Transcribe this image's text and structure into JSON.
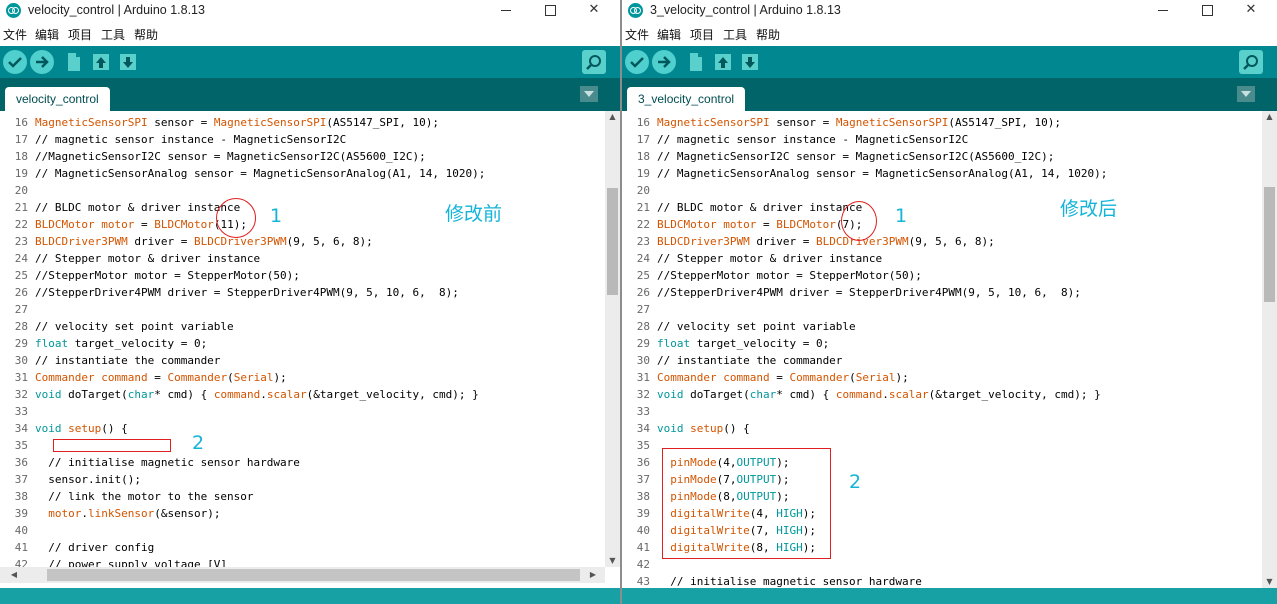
{
  "windows": {
    "left": {
      "title": "velocity_control | Arduino 1.8.13",
      "tab_label": "velocity_control",
      "menu": [
        "文件",
        "编辑",
        "项目",
        "工具",
        "帮助"
      ],
      "code_lines": [
        {
          "n": "16",
          "tokens": [
            {
              "t": "MagneticSensorSPI",
              "c": "o"
            },
            {
              "t": " sensor = ",
              "c": "p"
            },
            {
              "t": "MagneticSensorSPI",
              "c": "o"
            },
            {
              "t": "(AS5147_SPI, 10);",
              "c": "p"
            }
          ]
        },
        {
          "n": "17",
          "tokens": [
            {
              "t": "// magnetic sensor instance - MagneticSensorI2C",
              "c": "p"
            }
          ]
        },
        {
          "n": "18",
          "tokens": [
            {
              "t": "//MagneticSensorI2C sensor = MagneticSensorI2C(AS5600_I2C);",
              "c": "p"
            }
          ]
        },
        {
          "n": "19",
          "tokens": [
            {
              "t": "// MagneticSensorAnalog sensor = MagneticSensorAnalog(A1, 14, 1020);",
              "c": "p"
            }
          ]
        },
        {
          "n": "20",
          "tokens": []
        },
        {
          "n": "21",
          "tokens": [
            {
              "t": "// BLDC motor & driver instance",
              "c": "p"
            }
          ]
        },
        {
          "n": "22",
          "tokens": [
            {
              "t": "BLDCMotor",
              "c": "o"
            },
            {
              "t": " ",
              "c": "p"
            },
            {
              "t": "motor",
              "c": "o"
            },
            {
              "t": " = ",
              "c": "p"
            },
            {
              "t": "BLDCMotor",
              "c": "o"
            },
            {
              "t": "(11);",
              "c": "p"
            }
          ]
        },
        {
          "n": "23",
          "tokens": [
            {
              "t": "BLDCDriver3PWM",
              "c": "o"
            },
            {
              "t": " driver = ",
              "c": "p"
            },
            {
              "t": "BLDCDriver3PWM",
              "c": "o"
            },
            {
              "t": "(9, 5, 6, 8);",
              "c": "p"
            }
          ]
        },
        {
          "n": "24",
          "tokens": [
            {
              "t": "// Stepper motor & driver instance",
              "c": "p"
            }
          ]
        },
        {
          "n": "25",
          "tokens": [
            {
              "t": "//StepperMotor motor = StepperMotor(50);",
              "c": "p"
            }
          ]
        },
        {
          "n": "26",
          "tokens": [
            {
              "t": "//StepperDriver4PWM driver = StepperDriver4PWM(9, 5, 10, 6,  8);",
              "c": "p"
            }
          ]
        },
        {
          "n": "27",
          "tokens": []
        },
        {
          "n": "28",
          "tokens": [
            {
              "t": "// velocity set point variable",
              "c": "p"
            }
          ]
        },
        {
          "n": "29",
          "tokens": [
            {
              "t": "float",
              "c": "b"
            },
            {
              "t": " target_velocity = 0;",
              "c": "p"
            }
          ]
        },
        {
          "n": "30",
          "tokens": [
            {
              "t": "// instantiate the commander",
              "c": "p"
            }
          ]
        },
        {
          "n": "31",
          "tokens": [
            {
              "t": "Commander",
              "c": "o"
            },
            {
              "t": " ",
              "c": "p"
            },
            {
              "t": "command",
              "c": "o"
            },
            {
              "t": " = ",
              "c": "p"
            },
            {
              "t": "Commander",
              "c": "o"
            },
            {
              "t": "(",
              "c": "p"
            },
            {
              "t": "Serial",
              "c": "o"
            },
            {
              "t": ");",
              "c": "p"
            }
          ]
        },
        {
          "n": "32",
          "tokens": [
            {
              "t": "void",
              "c": "b"
            },
            {
              "t": " doTarget(",
              "c": "p"
            },
            {
              "t": "char",
              "c": "b"
            },
            {
              "t": "* cmd) { ",
              "c": "p"
            },
            {
              "t": "command",
              "c": "o"
            },
            {
              "t": ".",
              "c": "p"
            },
            {
              "t": "scalar",
              "c": "o"
            },
            {
              "t": "(&target_velocity, cmd); }",
              "c": "p"
            }
          ]
        },
        {
          "n": "33",
          "tokens": []
        },
        {
          "n": "34",
          "tokens": [
            {
              "t": "void",
              "c": "b"
            },
            {
              "t": " ",
              "c": "p"
            },
            {
              "t": "setup",
              "c": "o"
            },
            {
              "t": "() {",
              "c": "p"
            }
          ]
        },
        {
          "n": "35",
          "tokens": []
        },
        {
          "n": "36",
          "tokens": [
            {
              "t": "  // initialise magnetic sensor hardware",
              "c": "p"
            }
          ]
        },
        {
          "n": "37",
          "tokens": [
            {
              "t": "  sensor.init();",
              "c": "p"
            }
          ]
        },
        {
          "n": "38",
          "tokens": [
            {
              "t": "  // link the motor to the sensor",
              "c": "p"
            }
          ]
        },
        {
          "n": "39",
          "tokens": [
            {
              "t": "  ",
              "c": "p"
            },
            {
              "t": "motor",
              "c": "o"
            },
            {
              "t": ".",
              "c": "p"
            },
            {
              "t": "linkSensor",
              "c": "o"
            },
            {
              "t": "(&sensor);",
              "c": "p"
            }
          ]
        },
        {
          "n": "40",
          "tokens": []
        },
        {
          "n": "41",
          "tokens": [
            {
              "t": "  // driver config",
              "c": "p"
            }
          ]
        },
        {
          "n": "42",
          "tokens": [
            {
              "t": "  // power supply voltage [V]",
              "c": "p"
            }
          ]
        }
      ],
      "annotations": {
        "num1": "1",
        "num2": "2",
        "label": "修改前"
      }
    },
    "right": {
      "title": "3_velocity_control | Arduino 1.8.13",
      "tab_label": "3_velocity_control",
      "menu": [
        "文件",
        "编辑",
        "项目",
        "工具",
        "帮助"
      ],
      "code_lines": [
        {
          "n": "16",
          "tokens": [
            {
              "t": "MagneticSensorSPI",
              "c": "o"
            },
            {
              "t": " sensor = ",
              "c": "p"
            },
            {
              "t": "MagneticSensorSPI",
              "c": "o"
            },
            {
              "t": "(AS5147_SPI, 10);",
              "c": "p"
            }
          ]
        },
        {
          "n": "17",
          "tokens": [
            {
              "t": "// magnetic sensor instance - MagneticSensorI2C",
              "c": "p"
            }
          ]
        },
        {
          "n": "18",
          "tokens": [
            {
              "t": "// MagneticSensorI2C sensor = MagneticSensorI2C(AS5600_I2C);",
              "c": "p"
            }
          ]
        },
        {
          "n": "19",
          "tokens": [
            {
              "t": "// MagneticSensorAnalog sensor = MagneticSensorAnalog(A1, 14, 1020);",
              "c": "p"
            }
          ]
        },
        {
          "n": "20",
          "tokens": []
        },
        {
          "n": "21",
          "tokens": [
            {
              "t": "// BLDC motor & driver instance",
              "c": "p"
            }
          ]
        },
        {
          "n": "22",
          "tokens": [
            {
              "t": "BLDCMotor",
              "c": "o"
            },
            {
              "t": " ",
              "c": "p"
            },
            {
              "t": "motor",
              "c": "o"
            },
            {
              "t": " = ",
              "c": "p"
            },
            {
              "t": "BLDCMotor",
              "c": "o"
            },
            {
              "t": "(7);",
              "c": "p"
            }
          ]
        },
        {
          "n": "23",
          "tokens": [
            {
              "t": "BLDCDriver3PWM",
              "c": "o"
            },
            {
              "t": " driver = ",
              "c": "p"
            },
            {
              "t": "BLDCDriver3PWM",
              "c": "o"
            },
            {
              "t": "(9, 5, 6, 8);",
              "c": "p"
            }
          ]
        },
        {
          "n": "24",
          "tokens": [
            {
              "t": "// Stepper motor & driver instance",
              "c": "p"
            }
          ]
        },
        {
          "n": "25",
          "tokens": [
            {
              "t": "//StepperMotor motor = StepperMotor(50);",
              "c": "p"
            }
          ]
        },
        {
          "n": "26",
          "tokens": [
            {
              "t": "//StepperDriver4PWM driver = StepperDriver4PWM(9, 5, 10, 6,  8);",
              "c": "p"
            }
          ]
        },
        {
          "n": "27",
          "tokens": []
        },
        {
          "n": "28",
          "tokens": [
            {
              "t": "// velocity set point variable",
              "c": "p"
            }
          ]
        },
        {
          "n": "29",
          "tokens": [
            {
              "t": "float",
              "c": "b"
            },
            {
              "t": " target_velocity = 0;",
              "c": "p"
            }
          ]
        },
        {
          "n": "30",
          "tokens": [
            {
              "t": "// instantiate the commander",
              "c": "p"
            }
          ]
        },
        {
          "n": "31",
          "tokens": [
            {
              "t": "Commander",
              "c": "o"
            },
            {
              "t": " ",
              "c": "p"
            },
            {
              "t": "command",
              "c": "o"
            },
            {
              "t": " = ",
              "c": "p"
            },
            {
              "t": "Commander",
              "c": "o"
            },
            {
              "t": "(",
              "c": "p"
            },
            {
              "t": "Serial",
              "c": "o"
            },
            {
              "t": ");",
              "c": "p"
            }
          ]
        },
        {
          "n": "32",
          "tokens": [
            {
              "t": "void",
              "c": "b"
            },
            {
              "t": " doTarget(",
              "c": "p"
            },
            {
              "t": "char",
              "c": "b"
            },
            {
              "t": "* cmd) { ",
              "c": "p"
            },
            {
              "t": "command",
              "c": "o"
            },
            {
              "t": ".",
              "c": "p"
            },
            {
              "t": "scalar",
              "c": "o"
            },
            {
              "t": "(&target_velocity, cmd); }",
              "c": "p"
            }
          ]
        },
        {
          "n": "33",
          "tokens": []
        },
        {
          "n": "34",
          "tokens": [
            {
              "t": "void",
              "c": "b"
            },
            {
              "t": " ",
              "c": "p"
            },
            {
              "t": "setup",
              "c": "o"
            },
            {
              "t": "() {",
              "c": "p"
            }
          ]
        },
        {
          "n": "35",
          "tokens": []
        },
        {
          "n": "36",
          "tokens": [
            {
              "t": "  ",
              "c": "p"
            },
            {
              "t": "pinMode",
              "c": "o"
            },
            {
              "t": "(4,",
              "c": "p"
            },
            {
              "t": "OUTPUT",
              "c": "b"
            },
            {
              "t": ");",
              "c": "p"
            }
          ]
        },
        {
          "n": "37",
          "tokens": [
            {
              "t": "  ",
              "c": "p"
            },
            {
              "t": "pinMode",
              "c": "o"
            },
            {
              "t": "(7,",
              "c": "p"
            },
            {
              "t": "OUTPUT",
              "c": "b"
            },
            {
              "t": ");",
              "c": "p"
            }
          ]
        },
        {
          "n": "38",
          "tokens": [
            {
              "t": "  ",
              "c": "p"
            },
            {
              "t": "pinMode",
              "c": "o"
            },
            {
              "t": "(8,",
              "c": "p"
            },
            {
              "t": "OUTPUT",
              "c": "b"
            },
            {
              "t": ");",
              "c": "p"
            }
          ]
        },
        {
          "n": "39",
          "tokens": [
            {
              "t": "  ",
              "c": "p"
            },
            {
              "t": "digitalWrite",
              "c": "o"
            },
            {
              "t": "(4, ",
              "c": "p"
            },
            {
              "t": "HIGH",
              "c": "b"
            },
            {
              "t": ");",
              "c": "p"
            }
          ]
        },
        {
          "n": "40",
          "tokens": [
            {
              "t": "  ",
              "c": "p"
            },
            {
              "t": "digitalWrite",
              "c": "o"
            },
            {
              "t": "(7, ",
              "c": "p"
            },
            {
              "t": "HIGH",
              "c": "b"
            },
            {
              "t": ");",
              "c": "p"
            }
          ]
        },
        {
          "n": "41",
          "tokens": [
            {
              "t": "  ",
              "c": "p"
            },
            {
              "t": "digitalWrite",
              "c": "o"
            },
            {
              "t": "(8, ",
              "c": "p"
            },
            {
              "t": "HIGH",
              "c": "b"
            },
            {
              "t": ");",
              "c": "p"
            }
          ]
        },
        {
          "n": "42",
          "tokens": []
        },
        {
          "n": "43",
          "tokens": [
            {
              "t": "  // initialise magnetic sensor hardware",
              "c": "p"
            }
          ]
        }
      ],
      "annotations": {
        "num1": "1",
        "num2": "2",
        "label": "修改后"
      }
    }
  },
  "colors": {
    "toolbar": "#00878f",
    "tabbar": "#006468",
    "statusbar": "#17a1a5",
    "keyword_orange": "#d35400",
    "keyword_teal": "#00979c",
    "annotation_red": "#e02020",
    "annotation_blue": "#14b4d8"
  }
}
